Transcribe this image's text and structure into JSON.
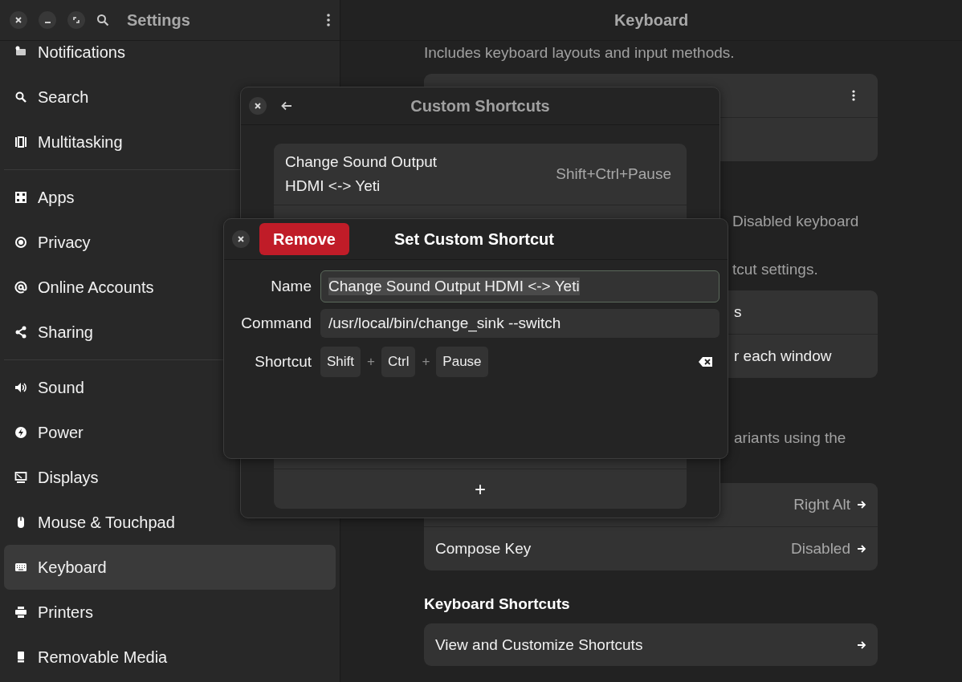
{
  "window": {
    "title": "Settings"
  },
  "sidebar": {
    "groups": [
      [
        {
          "label": "Notifications",
          "selected": false
        },
        {
          "label": "Search",
          "selected": false
        },
        {
          "label": "Multitasking",
          "selected": false
        }
      ],
      [
        {
          "label": "Apps",
          "selected": false
        },
        {
          "label": "Privacy",
          "selected": false
        },
        {
          "label": "Online Accounts",
          "selected": false
        },
        {
          "label": "Sharing",
          "selected": false
        }
      ],
      [
        {
          "label": "Sound",
          "selected": false
        },
        {
          "label": "Power",
          "selected": false
        },
        {
          "label": "Displays",
          "selected": false
        },
        {
          "label": "Mouse & Touchpad",
          "selected": false
        },
        {
          "label": "Keyboard",
          "selected": true
        },
        {
          "label": "Printers",
          "selected": false
        },
        {
          "label": "Removable Media",
          "selected": false
        }
      ]
    ]
  },
  "main": {
    "title": "Keyboard",
    "caption": "Includes keyboard layouts and input methods.",
    "paragraph_fragments_1": [
      "Disabled keyboard",
      "tcut settings."
    ],
    "row_fragments": [
      "s",
      "r each window"
    ],
    "paragraph_fragment_2": "ariants using the",
    "special_character_rows": [
      {
        "value": "Right Alt"
      },
      {
        "label": "Compose Key",
        "value": "Disabled"
      }
    ],
    "shortcuts_heading": "Keyboard Shortcuts",
    "shortcuts_row": "View and Customize Shortcuts"
  },
  "custom_shortcuts_dialog": {
    "title": "Custom Shortcuts",
    "shortcuts": [
      {
        "name": "Change Sound Output HDMI <-> Yeti",
        "accelerator": "Shift+Ctrl+Pause"
      }
    ],
    "add_label": "+"
  },
  "set_shortcut_dialog": {
    "title": "Set Custom Shortcut",
    "remove_label": "Remove",
    "fields": [
      {
        "label": "Name",
        "value": "Change Sound Output HDMI <-> Yeti",
        "focused": true
      },
      {
        "label": "Command",
        "value": "/usr/local/bin/change_sink --switch",
        "focused": false
      }
    ],
    "shortcut_label": "Shortcut",
    "keys": [
      {
        "kind": "key",
        "label": "Shift"
      },
      {
        "kind": "plus",
        "label": "+"
      },
      {
        "kind": "key",
        "label": "Ctrl"
      },
      {
        "kind": "plus",
        "label": "+"
      },
      {
        "kind": "key",
        "label": "Pause"
      }
    ]
  }
}
